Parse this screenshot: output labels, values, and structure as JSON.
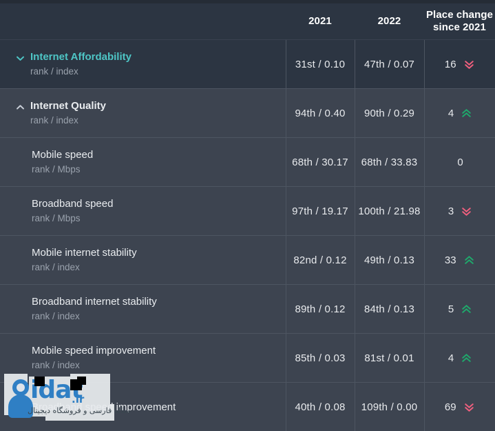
{
  "table": {
    "columns": {
      "metric": "",
      "year_2021": "2021",
      "year_2022": "2022",
      "change_line1": "Place change",
      "change_line2": "since 2021"
    },
    "rows": [
      {
        "title": "Internet Affordability",
        "subtitle": "rank / index",
        "type": "group",
        "state": "collapsed",
        "toggle_icon": "chevron-down-icon",
        "v2021": "31st / 0.10",
        "v2022": "47th / 0.07",
        "change": "16",
        "change_dir": "down",
        "change_icon": "double-chevron-down-icon"
      },
      {
        "title": "Internet Quality",
        "subtitle": "rank / index",
        "type": "group",
        "state": "expanded",
        "toggle_icon": "chevron-up-icon",
        "v2021": "94th / 0.40",
        "v2022": "90th / 0.29",
        "change": "4",
        "change_dir": "up",
        "change_icon": "double-chevron-up-icon"
      },
      {
        "title": "Mobile speed",
        "subtitle": "rank / Mbps",
        "type": "child",
        "v2021": "68th / 30.17",
        "v2022": "68th / 33.83",
        "change": "0",
        "change_dir": "none",
        "change_icon": ""
      },
      {
        "title": "Broadband speed",
        "subtitle": "rank / Mbps",
        "type": "child",
        "v2021": "97th / 19.17",
        "v2022": "100th / 21.98",
        "change": "3",
        "change_dir": "down",
        "change_icon": "double-chevron-down-icon"
      },
      {
        "title": "Mobile internet stability",
        "subtitle": "rank / index",
        "type": "child",
        "v2021": "82nd / 0.12",
        "v2022": "49th / 0.13",
        "change": "33",
        "change_dir": "up",
        "change_icon": "double-chevron-up-icon"
      },
      {
        "title": "Broadband internet stability",
        "subtitle": "rank / index",
        "type": "child",
        "v2021": "89th / 0.12",
        "v2022": "84th / 0.13",
        "change": "5",
        "change_dir": "up",
        "change_icon": "double-chevron-up-icon"
      },
      {
        "title": "Mobile speed improvement",
        "subtitle": "rank / index",
        "type": "child",
        "v2021": "85th / 0.03",
        "v2022": "81st / 0.01",
        "change": "4",
        "change_dir": "up",
        "change_icon": "double-chevron-up-icon"
      },
      {
        "title": "Broadband speed improvement",
        "subtitle": "",
        "type": "child",
        "v2021": "40th / 0.08",
        "v2022": "109th / 0.00",
        "change": "69",
        "change_dir": "down",
        "change_icon": "double-chevron-down-icon"
      }
    ]
  },
  "watermark": {
    "brand": "idat",
    "tld": ".ir",
    "tagline": "مقاله فارسی و فروشگاه دیجیتال"
  },
  "colors": {
    "header_bg": "#2c3542",
    "row_bg": "#3d4450",
    "row_bg_alt": "#2c3542",
    "accent": "#4ec6c6",
    "up": "#1fa86b",
    "down": "#ef5f7e",
    "text": "#e9ecef",
    "muted": "#9aa2ad",
    "divider": "#4d5561"
  }
}
